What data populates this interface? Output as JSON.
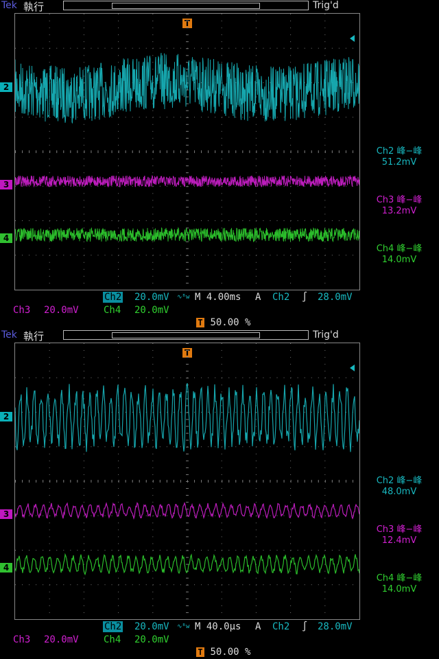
{
  "panels": [
    {
      "header": {
        "brand": "Tek",
        "run_state": "執行",
        "trigger_state": "Trig'd"
      },
      "trigger_marker": "T",
      "markers": [
        "2",
        "3",
        "4"
      ],
      "measurements": [
        {
          "label": "Ch2 峰−峰",
          "value": "51.2mV"
        },
        {
          "label": "Ch3 峰−峰",
          "value": "13.2mV"
        },
        {
          "label": "Ch4 峰−峰",
          "value": "14.0mV"
        }
      ],
      "status": {
        "ch2": "Ch2",
        "ch2_scale": "20.0mV",
        "bw": "∿ᴮw",
        "timebase": "M 4.00ms",
        "acq": "A",
        "trig_src": "Ch2",
        "trig_slope": "∫",
        "trig_level": "28.0mV",
        "ch3": "Ch3",
        "ch3_scale": "20.0mV",
        "ch4": "Ch4",
        "ch4_scale": "20.0mV",
        "pos_badge": "T",
        "pos": "50.00 %"
      },
      "waveform_style": "noise"
    },
    {
      "header": {
        "brand": "Tek",
        "run_state": "執行",
        "trigger_state": "Trig'd"
      },
      "trigger_marker": "T",
      "markers": [
        "2",
        "3",
        "4"
      ],
      "measurements": [
        {
          "label": "Ch2 峰−峰",
          "value": "48.0mV"
        },
        {
          "label": "Ch3 峰−峰",
          "value": "12.4mV"
        },
        {
          "label": "Ch4 峰−峰",
          "value": "14.0mV"
        }
      ],
      "status": {
        "ch2": "Ch2",
        "ch2_scale": "20.0mV",
        "bw": "∿ᴮw",
        "timebase": "M 40.0µs",
        "acq": "A",
        "trig_src": "Ch2",
        "trig_slope": "∫",
        "trig_level": "28.0mV",
        "ch3": "Ch3",
        "ch3_scale": "20.0mV",
        "ch4": "Ch4",
        "ch4_scale": "20.0mV",
        "pos_badge": "T",
        "pos": "50.00 %"
      },
      "waveform_style": "oscillation"
    }
  ],
  "colors": {
    "ch2": "#18b8c0",
    "ch3": "#d020d0",
    "ch4": "#30d030",
    "trigger": "#e07a10",
    "grid": "#777777"
  }
}
